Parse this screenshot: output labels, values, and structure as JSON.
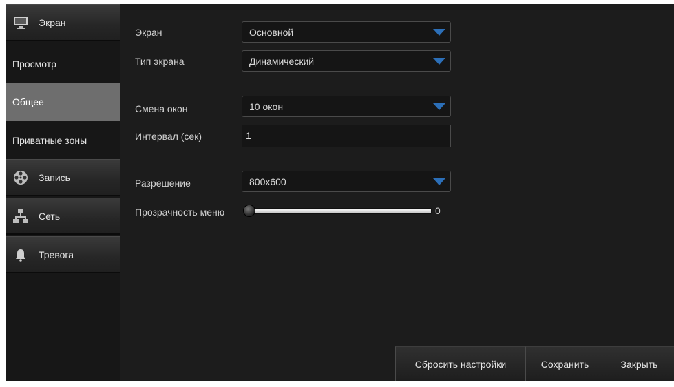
{
  "sidebar": {
    "screen_label": "Экран",
    "view_label": "Просмотр",
    "general_label": "Общее",
    "privacy_label": "Приватные зоны",
    "record_label": "Запись",
    "network_label": "Сеть",
    "alarm_label": "Тревога",
    "icons": {
      "screen": "monitor-icon",
      "record": "film-reel-icon",
      "network": "network-icon",
      "alarm": "bell-icon"
    }
  },
  "form": {
    "screen": {
      "label": "Экран",
      "value": "Основной"
    },
    "screen_type": {
      "label": "Тип экрана",
      "value": "Динамический"
    },
    "window_switch": {
      "label": "Смена окон",
      "value": "10 окон"
    },
    "interval": {
      "label": "Интервал (сек)",
      "value": "1"
    },
    "resolution": {
      "label": "Разрешение",
      "value": "800x600"
    },
    "menu_transparency": {
      "label": "Прозрачность меню",
      "value": "0",
      "level": 0
    }
  },
  "buttons": {
    "reset": "Сбросить настройки",
    "save": "Сохранить",
    "close": "Закрыть"
  },
  "colors": {
    "accent_arrow": "#2c6fb8",
    "active_item": "#6e6e6e"
  }
}
